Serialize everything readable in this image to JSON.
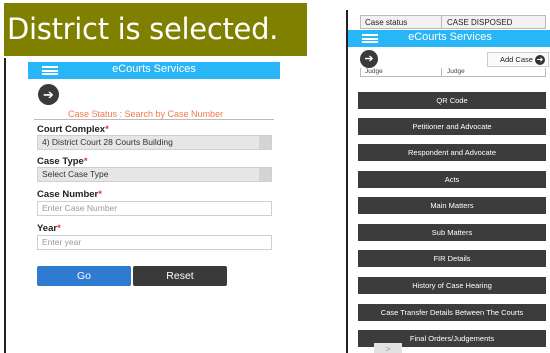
{
  "caption": "District is selected.",
  "left_screen": {
    "app_title": "eCourts Services",
    "back_icon": "back-arrow-icon",
    "form_title": "Case Status : Search by Case Number",
    "court_complex": {
      "label": "Court Complex",
      "required": "*",
      "value": "4) District Court 28 Courts Building"
    },
    "case_type": {
      "label": "Case Type",
      "required": "*",
      "value": "Select Case Type"
    },
    "case_number": {
      "label": "Case Number",
      "required": "*",
      "placeholder": "Enter Case Number"
    },
    "year": {
      "label": "Year",
      "required": "*",
      "placeholder": "Enter year"
    },
    "go_label": "Go",
    "reset_label": "Reset"
  },
  "right_screen": {
    "status_label": "Case status",
    "status_value": "CASE DISPOSED",
    "app_title": "eCourts Services",
    "add_case_label": "Add Case",
    "judge_col1": "Judge",
    "judge_col2": "Judge",
    "buttons": [
      "QR Code",
      "Petitioner and Advocate",
      "Respondent and Advocate",
      "Acts",
      "Main Matters",
      "Sub Matters",
      "FIR Details",
      "History of Case Hearing",
      "Case Transfer Details Between The Courts",
      "Final Orders/Judgements"
    ]
  },
  "colors": {
    "caption_bg": "#7f7f00",
    "app_bar": "#29b6f6",
    "go_button": "#2f7bd0",
    "dark_button": "#3a3a3a",
    "form_title": "#f07a4f"
  }
}
